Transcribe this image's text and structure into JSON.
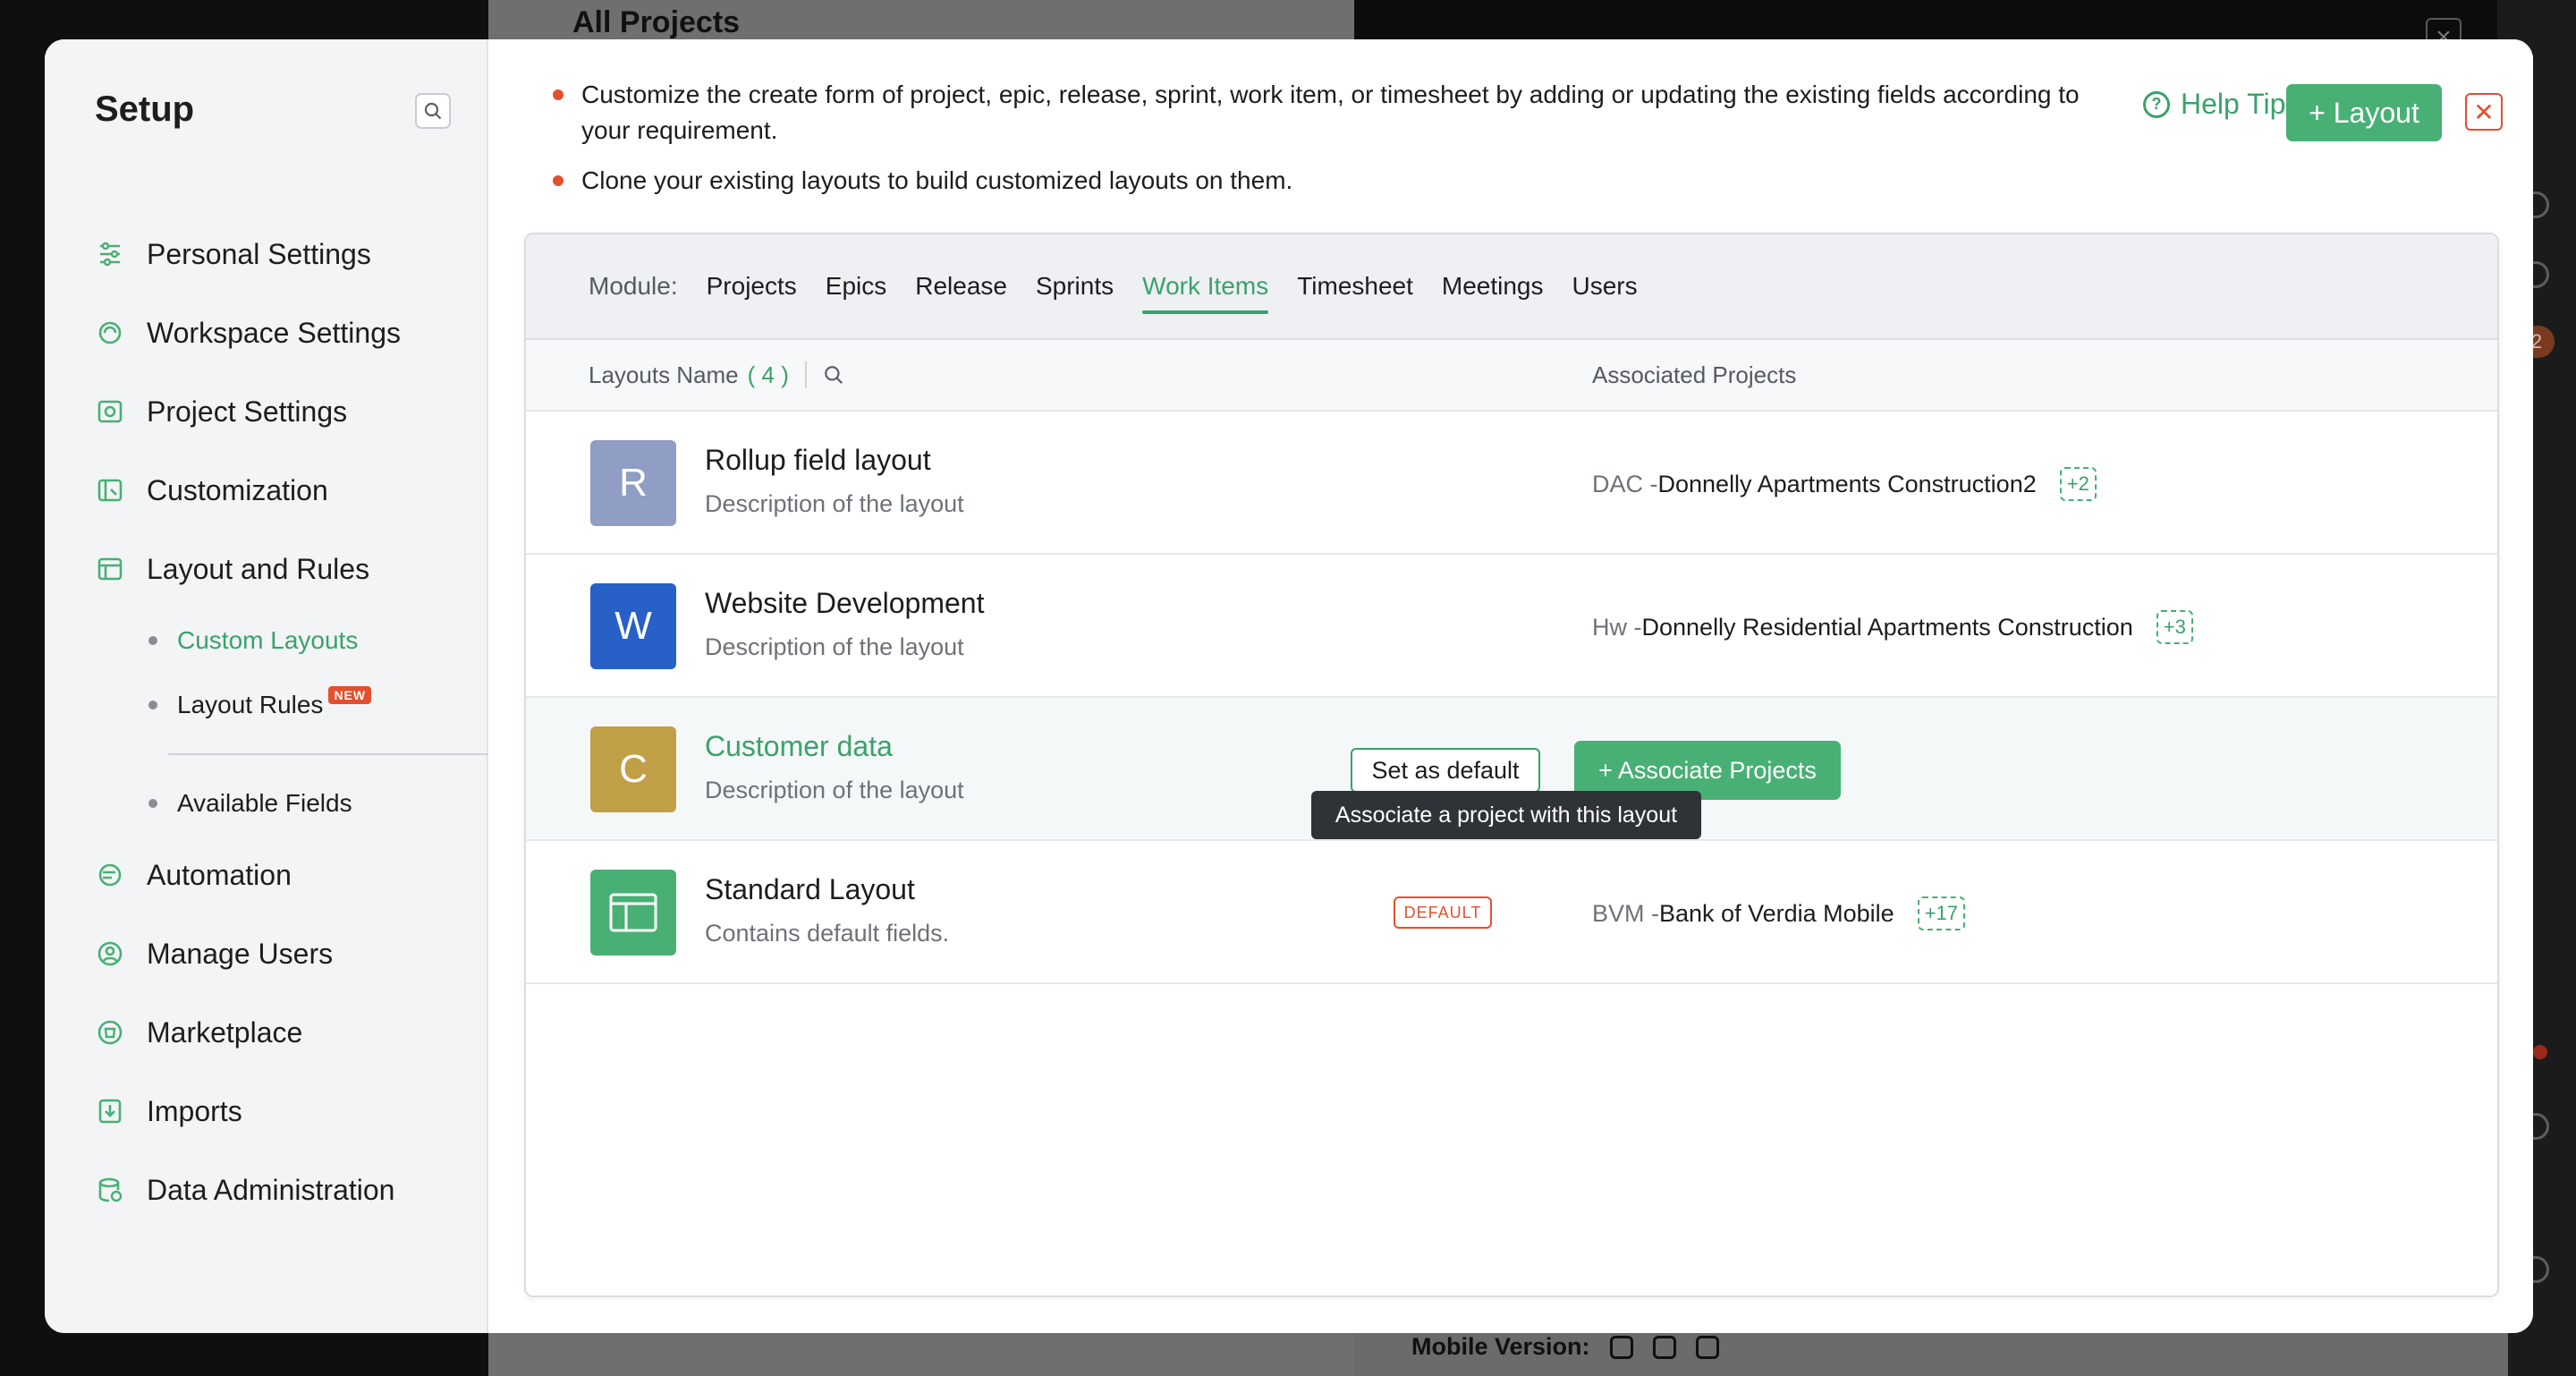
{
  "background": {
    "page_title": "All Projects",
    "mobile_label": "Mobile Version:",
    "rail_badge": "2"
  },
  "sidebar": {
    "title": "Setup",
    "items": [
      {
        "label": "Personal Settings",
        "icon": "sliders-icon"
      },
      {
        "label": "Workspace Settings",
        "icon": "workspace-icon"
      },
      {
        "label": "Project Settings",
        "icon": "project-icon"
      },
      {
        "label": "Customization",
        "icon": "customization-icon"
      },
      {
        "label": "Layout and Rules",
        "icon": "layout-icon"
      }
    ],
    "subitems": [
      {
        "label": "Custom Layouts",
        "active": true
      },
      {
        "label": "Layout Rules",
        "badge": "NEW"
      },
      {
        "label": "Available Fields"
      }
    ],
    "items2": [
      {
        "label": "Automation",
        "icon": "automation-icon"
      },
      {
        "label": "Manage Users",
        "icon": "users-icon"
      },
      {
        "label": "Marketplace",
        "icon": "marketplace-icon"
      },
      {
        "label": "Imports",
        "icon": "import-icon"
      },
      {
        "label": "Data Administration",
        "icon": "database-icon"
      }
    ]
  },
  "header": {
    "tips": [
      "Customize the create form of project, epic, release, sprint, work item, or timesheet by adding or updating the existing fields according to your requirement.",
      "Clone your existing layouts to build customized layouts on them."
    ],
    "help_tips": "Help Tips",
    "add_layout": "+ Layout",
    "close": "✕"
  },
  "module": {
    "label": "Module:",
    "tabs": [
      "Projects",
      "Epics",
      "Release",
      "Sprints",
      "Work Items",
      "Timesheet",
      "Meetings",
      "Users"
    ],
    "active": "Work Items"
  },
  "table": {
    "col_name": "Layouts Name",
    "count": "( 4 )",
    "col_assoc": "Associated Projects",
    "rows": [
      {
        "initial": "R",
        "color": "#909dc4",
        "name": "Rollup field layout",
        "desc": "Description of the layout",
        "code": "DAC - ",
        "project": "Donnelly Apartments Construction2",
        "more": "+2"
      },
      {
        "initial": "W",
        "color": "#2760c7",
        "name": "Website Development",
        "desc": "Description of the layout",
        "code": "Hw - ",
        "project": "Donnelly Residential Apartments Construction",
        "more": "+3"
      },
      {
        "initial": "C",
        "color": "#c19f47",
        "name": "Customer data",
        "desc": "Description of the layout",
        "set_default": "Set as default",
        "associate": "+ Associate Projects"
      },
      {
        "initial": "",
        "color": "#48b074",
        "name": "Standard Layout",
        "desc": "Contains default fields.",
        "badge": "DEFAULT",
        "code": "BVM - ",
        "project": "Bank of Verdia Mobile",
        "more": "+17"
      }
    ],
    "tooltip": "Associate a project with this layout"
  },
  "colors": {
    "accent": "#48b074",
    "accent_text": "#3aa26a",
    "danger": "#e2502e"
  }
}
